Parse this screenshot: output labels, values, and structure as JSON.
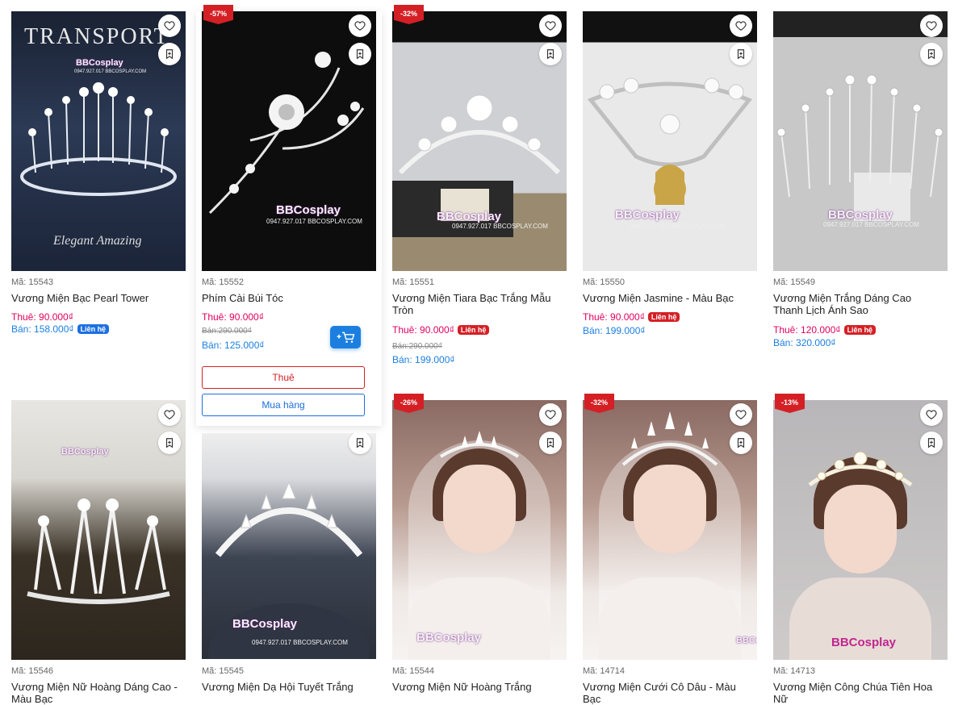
{
  "accent": {
    "rent": "#e3005f",
    "sale": "#1c7fe0",
    "badge": "#d42025"
  },
  "watermark": "BBCosplay",
  "watermark_sub": "0947.927.017 BBCOSPLAY.COM",
  "image_text": {
    "transport": "TRANSPORT",
    "elegant": "Elegant Amazing"
  },
  "labels": {
    "rent_btn": "Thuê",
    "buy_btn": "Mua hàng",
    "contact": "Liên hệ"
  },
  "icons": {
    "favorite": "heart-icon",
    "bookmark": "bookmark-icon",
    "cart": "add-cart-icon"
  },
  "products": [
    {
      "code": "Mã: 15543",
      "name": "Vương Miện Bạc Pearl Tower",
      "rent": "Thuê: 90.000₫",
      "sale": "Bán: 158.000₫",
      "sale_contact": "Liên hệ"
    },
    {
      "code": "Mã: 15552",
      "name": "Phím Cài Búi Tóc",
      "badge": "-57%",
      "rent": "Thuê: 90.000₫",
      "old": "Bán:290.000₫",
      "sale": "Bán: 125.000₫"
    },
    {
      "code": "Mã: 15551",
      "name": "Vương Miện Tiara Bạc Trắng Mẫu Tròn",
      "badge": "-32%",
      "rent": "Thuê: 90.000₫",
      "rent_contact": "Liên hệ",
      "old": "Bán:290.000₫",
      "sale": "Bán: 199.000₫"
    },
    {
      "code": "Mã: 15550",
      "name": "Vương Miện Jasmine - Màu Bạc",
      "rent": "Thuê: 90.000₫",
      "rent_contact": "Liên hệ",
      "sale": "Bán: 199.000₫"
    },
    {
      "code": "Mã: 15549",
      "name": "Vương Miện Trắng Dáng Cao Thanh Lịch Ánh Sao",
      "rent": "Thuê: 120.000₫",
      "rent_contact": "Liên hệ",
      "sale": "Bán: 320.000₫"
    },
    {
      "code": "Mã: 15546",
      "name": "Vương Miện Nữ Hoàng Dáng Cao - Màu Bạc"
    },
    {
      "code": "Mã: 15545",
      "name": "Vương Miện Dạ Hội Tuyết Trắng"
    },
    {
      "code": "Mã: 15544",
      "name": "Vương Miện Nữ Hoàng Trắng",
      "badge": "-26%"
    },
    {
      "code": "Mã: 14714",
      "name": "Vương Miện Cưới Cô Dâu - Màu Bạc",
      "badge": "-32%"
    },
    {
      "code": "Mã: 14713",
      "name": "Vương Miện Công Chúa Tiên Hoa Nữ",
      "badge": "-13%"
    }
  ]
}
